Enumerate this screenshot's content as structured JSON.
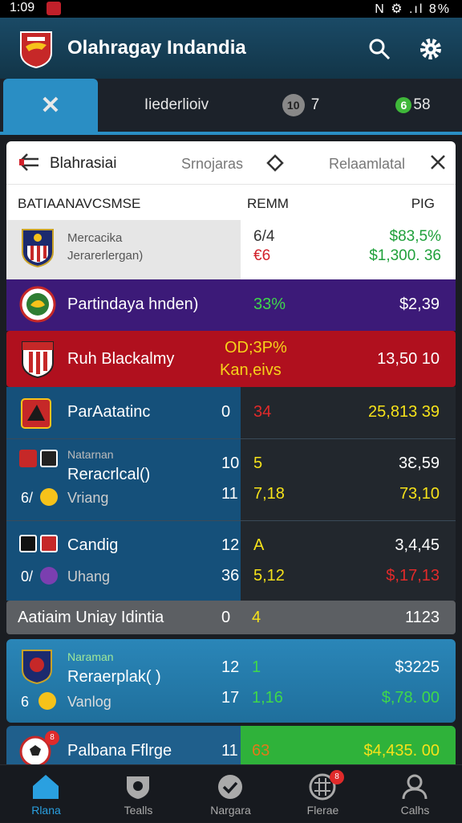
{
  "status_bar": {
    "time": "1:09",
    "right": "N ⚙ .ıl 8%"
  },
  "app": {
    "title": "Olahragay Indandia",
    "primary_color": "#2a8ec4"
  },
  "tabs": [
    {
      "label": "✕"
    },
    {
      "label": "Iiederlioiv"
    },
    {
      "badge": "10",
      "label": "7"
    },
    {
      "badge": "6",
      "label": "58"
    }
  ],
  "card": {
    "title": "Blahrasiai",
    "subtitle": "Srnojaras",
    "right": "Relaamlatal",
    "columns": [
      "BATIAANAVCSMSE",
      "REMM",
      "PIG"
    ],
    "row": {
      "line1": "Mercacika",
      "line2": "Jerarerlergan)",
      "v1": "6/4",
      "v2": "€6",
      "p1": "$83,5%",
      "p2": "$1,300. 36"
    }
  },
  "rows": {
    "purple": {
      "name": "Partindaya hnden)",
      "pct": "33%",
      "price": "$2,39"
    },
    "red": {
      "name": "Ruh Blackalmy",
      "odds1": "OD;3P%",
      "odds2": "Kan,eivs",
      "price": "13,50 10"
    },
    "r3": {
      "name": "ParAatatinc",
      "n": "0",
      "v": "34",
      "price": "25,813 39"
    },
    "r4": {
      "top": "Natarnan",
      "name": "Reracrlcal()",
      "sub_prefix": "6/",
      "sub": "Vriang",
      "n1": "10",
      "v1": "5",
      "p1": "3Ɛ,59",
      "n2": "11",
      "v2": "7,18",
      "p2": "73,10"
    },
    "r5": {
      "name": "Candig",
      "sub_prefix": "0/",
      "sub": "Uhang",
      "n1": "12",
      "v1": "A",
      "p1": "3,4,45",
      "n2": "36",
      "v2": "5,12",
      "p2": "$,17,13"
    },
    "grey": {
      "name": "Aatiaim Uniay Idintia",
      "n": "0",
      "v": "4",
      "price": "1123"
    },
    "blue2": {
      "top": "Naraman",
      "name": "Reraerplak( )",
      "sub_prefix": "6",
      "sub": "Vanlog",
      "n1": "12",
      "v1": "1",
      "p1": "$3225",
      "n2": "17",
      "v2": "1,16",
      "p2": "$,78. 00"
    },
    "last": {
      "name": "Palbana Fflrge",
      "n": "11",
      "v": "63",
      "price": "$4,435. 00",
      "badge": "8"
    }
  },
  "nav": [
    {
      "label": "Rlana"
    },
    {
      "label": "Tealls"
    },
    {
      "label": "Nargara"
    },
    {
      "label": "Flerae",
      "badge": "8"
    },
    {
      "label": "Calhs"
    }
  ]
}
